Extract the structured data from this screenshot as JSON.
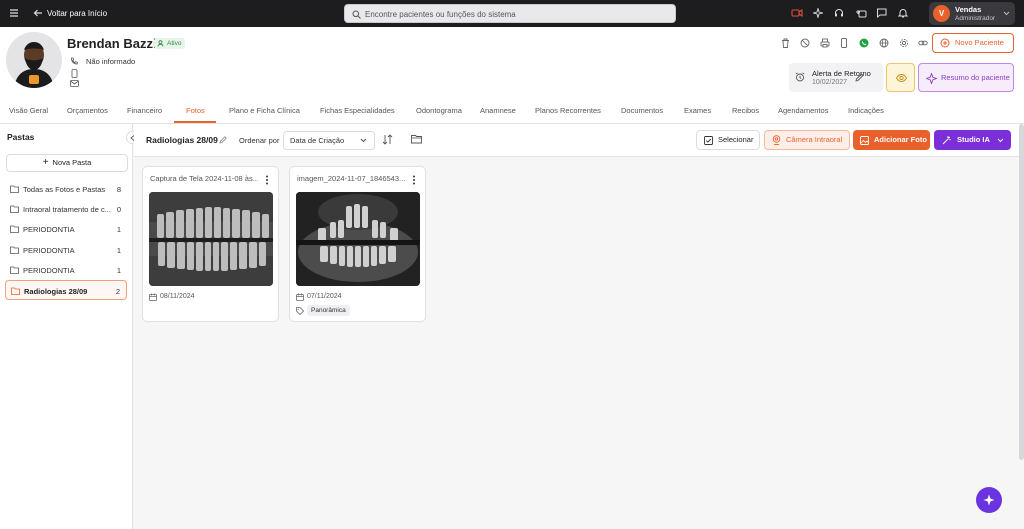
{
  "topbar": {
    "back_label": "Voltar para Início",
    "search_placeholder": "Encontre pacientes ou funções do sistema",
    "icons": [
      "video-icon",
      "sparkle-icon",
      "headset-icon",
      "clock-icon",
      "chat-icon",
      "bell-icon"
    ],
    "user": {
      "initial": "V",
      "name": "Vendas",
      "role": "Administrador"
    }
  },
  "patient": {
    "name": "Brendan Bazzi",
    "status": "Ativo",
    "phone": "Não informado",
    "action_icons": [
      "trash-icon",
      "block-icon",
      "print-icon",
      "mobile-icon",
      "whatsapp-icon",
      "globe-icon",
      "settings-icon",
      "link-icon"
    ],
    "new_patient_label": "Novo Paciente",
    "alert": {
      "title": "Alerta de Retorno",
      "date": "10/02/2027"
    },
    "summary_label": "Resumo do paciente"
  },
  "tabs": [
    "Visão Geral",
    "Orçamentos",
    "Financeiro",
    "Fotos",
    "Plano e Ficha Clínica",
    "Fichas Especialidades",
    "Odontograma",
    "Anamnese",
    "Planos Recorrentes",
    "Documentos",
    "Exames",
    "Recibos",
    "Agendamentos",
    "Indicações"
  ],
  "active_tab": "Fotos",
  "sidebar": {
    "title": "Pastas",
    "new_folder_label": "Nova Pasta",
    "folders": [
      {
        "label": "Todas as Fotos e Pastas",
        "count": "8"
      },
      {
        "label": "Intraoral tratamento de c...",
        "count": "0"
      },
      {
        "label": "PERIODONTIA",
        "count": "1"
      },
      {
        "label": "PERIODONTIA",
        "count": "1"
      },
      {
        "label": "PERIODONTIA",
        "count": "1"
      },
      {
        "label": "Radiologias 28/09",
        "count": "2"
      }
    ]
  },
  "content": {
    "title": "Radiologias 28/09",
    "order_label": "Ordenar por",
    "order_value": "Data de Criação",
    "select_label": "Selecionar",
    "camera_label": "Câmera Intraoral",
    "add_photo_label": "Adicionar Foto",
    "studio_label": "Studio IA",
    "cards": [
      {
        "title": "Captura de Tela 2024-11-08 às...",
        "date": "08/11/2024",
        "tag": ""
      },
      {
        "title": "imagem_2024-11-07_1846543...",
        "date": "07/11/2024",
        "tag": "Panorâmica"
      }
    ]
  },
  "colors": {
    "accent": "#e8612c",
    "purple": "#7c2fd9",
    "dark": "#1d1d1f"
  }
}
